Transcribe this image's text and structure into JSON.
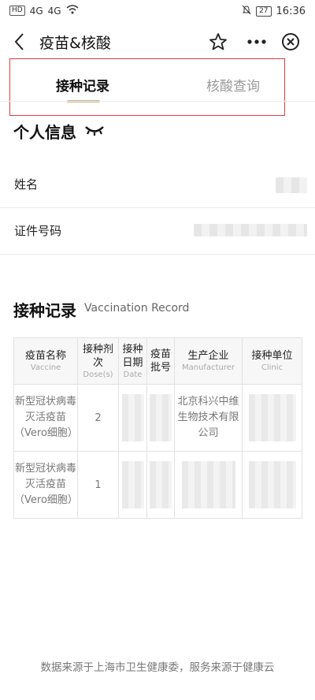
{
  "status_bar": {
    "carrier_badge": "HD",
    "signal_1": "4G",
    "signal_2": "4G",
    "battery": "27",
    "time": "16:36"
  },
  "header": {
    "title": "疫苗&核酸"
  },
  "tabs": [
    {
      "label": "接种记录",
      "active": true
    },
    {
      "label": "核酸查询",
      "active": false
    }
  ],
  "personal": {
    "title": "个人信息",
    "name_label": "姓名",
    "id_label": "证件号码"
  },
  "vaccination": {
    "title": "接种记录",
    "title_en": "Vaccination Record",
    "columns": [
      {
        "cn": "疫苗名称",
        "en": "Vaccine"
      },
      {
        "cn": "接种剂次",
        "en": "Dose(s)"
      },
      {
        "cn": "接种日期",
        "en": "Date"
      },
      {
        "cn": "疫苗批号",
        "en": ""
      },
      {
        "cn": "生产企业",
        "en": "Manufacturer"
      },
      {
        "cn": "接种单位",
        "en": "Clinic"
      }
    ],
    "rows": [
      {
        "vaccine": "新型冠状病毒灭活疫苗（Vero细胞）",
        "dose": "2",
        "manufacturer": "北京科兴中维生物技术有限公司"
      },
      {
        "vaccine": "新型冠状病毒灭活疫苗（Vero细胞）",
        "dose": "1",
        "manufacturer": ""
      }
    ]
  },
  "footer": {
    "text": "数据来源于上海市卫生健康委，服务来源于健康云"
  },
  "colors": {
    "accent_underline": "#c8b690",
    "highlight_border": "#e23b3b"
  }
}
